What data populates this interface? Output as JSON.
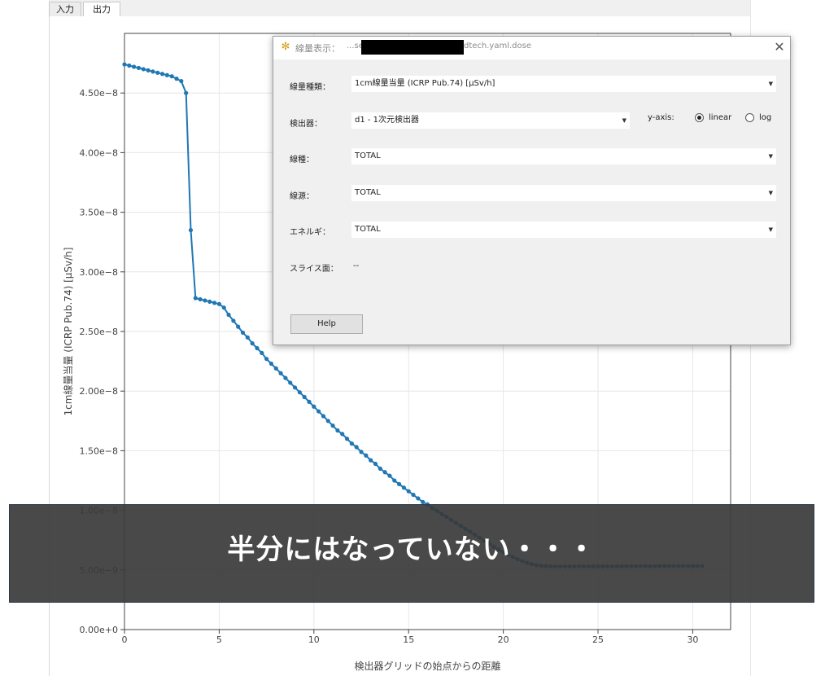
{
  "tabs": [
    {
      "label": "入力"
    },
    {
      "label": "出力"
    }
  ],
  "dialog": {
    "title": "線量表示：",
    "path_prefix": "...se",
    "path_suffix": "dtech.yaml.dose",
    "close_icon": "✕",
    "fields": [
      {
        "label": "線量種類：",
        "value": "1cm線量当量 (ICRP Pub.74)  [μSv/h]"
      },
      {
        "label": "検出器：",
        "value": "d1  - 1次元検出器"
      },
      {
        "label": "線種：",
        "value": "TOTAL"
      },
      {
        "label": "線源：",
        "value": "TOTAL"
      },
      {
        "label": "エネルギ：",
        "value": "TOTAL"
      }
    ],
    "slice_label": "スライス面：",
    "slice_value": "--",
    "yaxis_label": "y-axis:",
    "yaxis_options": [
      {
        "label": "linear",
        "checked": true
      },
      {
        "label": "log",
        "checked": false
      }
    ],
    "help_label": "Help",
    "icon": "gear-icon"
  },
  "overlay": {
    "text": "半分にはなっていない・・・"
  },
  "chart_data": {
    "type": "line",
    "xlabel": "検出器グリッドの始点からの距離",
    "ylabel": "1cm線量当量 (ICRP Pub.74) [μSv/h]",
    "xlim": [
      0,
      32
    ],
    "ylim": [
      0,
      5e-08
    ],
    "xticks": [
      "0",
      "5",
      "10",
      "15",
      "20",
      "25",
      "30"
    ],
    "yticks": [
      "0.00e+0",
      "5.00e−9",
      "1.00e−8",
      "1.50e−8",
      "2.00e−8",
      "2.50e−8",
      "3.00e−8",
      "3.50e−8",
      "4.00e−8",
      "4.50e−8"
    ],
    "ytick_values": [
      0,
      5e-09,
      1e-08,
      1.5e-08,
      2e-08,
      2.5e-08,
      3e-08,
      3.5e-08,
      4e-08,
      4.5e-08
    ],
    "line_color": "#1f77b4",
    "grid": true,
    "series": [
      {
        "x": [
          0,
          0.25,
          0.5,
          0.75,
          1.0,
          1.25,
          1.5,
          1.75,
          2.0,
          2.25,
          2.5,
          2.75,
          3.0,
          3.25,
          3.5,
          3.75,
          4.0,
          4.25,
          4.5,
          4.75,
          5.0,
          5.25,
          5.5,
          5.75,
          6.0,
          6.25,
          6.5,
          6.75,
          7.0,
          7.25,
          7.5,
          7.75,
          8.0,
          8.25,
          8.5,
          8.75,
          9.0,
          9.25,
          9.5,
          9.75,
          10.0,
          10.25,
          10.5,
          10.75,
          11.0,
          11.25,
          11.5,
          11.75,
          12.0,
          12.25,
          12.5,
          12.75,
          13.0,
          13.25,
          13.5,
          13.75,
          14.0,
          14.25,
          14.5,
          14.75,
          15.0,
          15.25,
          15.5,
          15.75,
          16.0,
          16.25,
          16.5,
          16.75,
          17.0,
          17.25,
          17.5,
          17.75,
          18.0,
          18.25,
          18.5,
          18.75,
          19.0,
          19.25,
          19.5,
          19.75,
          20.0,
          20.25,
          20.5,
          20.75,
          21.0,
          21.25,
          21.5,
          21.75,
          22.0,
          22.25,
          22.5,
          22.75,
          23.0,
          23.25,
          23.5,
          23.75,
          24.0,
          24.25,
          24.5,
          24.75,
          25.0,
          25.25,
          25.5,
          25.75,
          26.0,
          26.25,
          26.5,
          26.75,
          27.0,
          27.25,
          27.5,
          27.75,
          28.0,
          28.25,
          28.5,
          28.75,
          29.0,
          29.25,
          29.5,
          29.75,
          30.0,
          30.25,
          30.5
        ],
        "y": [
          4.74e-08,
          4.73e-08,
          4.72e-08,
          4.71e-08,
          4.7e-08,
          4.69e-08,
          4.68e-08,
          4.67e-08,
          4.66e-08,
          4.65e-08,
          4.64e-08,
          4.62e-08,
          4.6e-08,
          4.5e-08,
          3.35e-08,
          2.78e-08,
          2.77e-08,
          2.76e-08,
          2.75e-08,
          2.74e-08,
          2.73e-08,
          2.7e-08,
          2.64e-08,
          2.59e-08,
          2.54e-08,
          2.49e-08,
          2.45e-08,
          2.4e-08,
          2.36e-08,
          2.32e-08,
          2.27e-08,
          2.23e-08,
          2.19e-08,
          2.15e-08,
          2.11e-08,
          2.07e-08,
          2.03e-08,
          1.99e-08,
          1.95e-08,
          1.91e-08,
          1.87e-08,
          1.83e-08,
          1.79e-08,
          1.75e-08,
          1.71e-08,
          1.67e-08,
          1.64e-08,
          1.6e-08,
          1.56e-08,
          1.53e-08,
          1.49e-08,
          1.46e-08,
          1.42e-08,
          1.39e-08,
          1.35e-08,
          1.32e-08,
          1.29e-08,
          1.25e-08,
          1.22e-08,
          1.19e-08,
          1.16e-08,
          1.13e-08,
          1.1e-08,
          1.07e-08,
          1.05e-08,
          1.02e-08,
          9.95e-09,
          9.7e-09,
          9.45e-09,
          9.2e-09,
          8.95e-09,
          8.7e-09,
          8.45e-09,
          8.2e-09,
          7.95e-09,
          7.7e-09,
          7.45e-09,
          7.2e-09,
          6.95e-09,
          6.7e-09,
          6.5e-09,
          6.3e-09,
          6.1e-09,
          5.9e-09,
          5.75e-09,
          5.6e-09,
          5.48e-09,
          5.4e-09,
          5.35e-09,
          5.32e-09,
          5.3e-09,
          5.29e-09,
          5.29e-09,
          5.3e-09,
          5.3e-09,
          5.3e-09,
          5.3e-09,
          5.3e-09,
          5.3e-09,
          5.3e-09,
          5.3e-09,
          5.3e-09,
          5.3e-09,
          5.3e-09,
          5.3e-09,
          5.31e-09,
          5.31e-09,
          5.31e-09,
          5.31e-09,
          5.32e-09,
          5.32e-09,
          5.32e-09,
          5.32e-09,
          5.32e-09,
          5.33e-09,
          5.33e-09,
          5.33e-09,
          5.33e-09,
          5.33e-09,
          5.33e-09,
          5.33e-09,
          5.33e-09,
          5.33e-09
        ]
      }
    ]
  }
}
